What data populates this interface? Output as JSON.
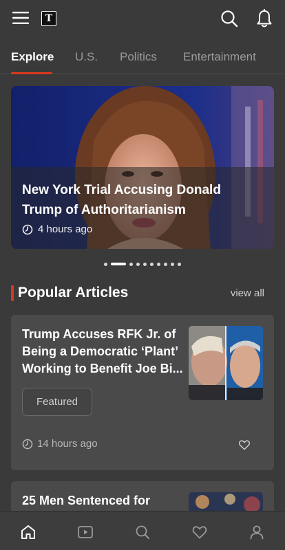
{
  "header": {
    "logo_text": "T",
    "icons": [
      "menu-icon",
      "logo-icon",
      "search-icon",
      "bell-icon"
    ]
  },
  "tabs": [
    {
      "label": "Explore",
      "active": true
    },
    {
      "label": "U.S.",
      "active": false
    },
    {
      "label": "Politics",
      "active": false
    },
    {
      "label": "Entertainment",
      "active": false
    }
  ],
  "hero": {
    "title": "New York Trial Accusing Donald Trump of Authoritarianism",
    "time": "4 hours ago",
    "carousel_count": 10,
    "carousel_active_index": 1
  },
  "popular": {
    "title": "Popular Articles",
    "view_all": "view all"
  },
  "articles": [
    {
      "title": "Trump Accuses RFK Jr. of Being a Democratic ‘Plant’ Working to Benefit Joe Bi...",
      "badge": "Featured",
      "time": "14 hours ago",
      "liked": false
    },
    {
      "title": "25 Men Sentenced for"
    }
  ],
  "bottom_nav": [
    {
      "name": "home",
      "active": true
    },
    {
      "name": "video",
      "active": false
    },
    {
      "name": "search",
      "active": false
    },
    {
      "name": "favorites",
      "active": false
    },
    {
      "name": "profile",
      "active": false
    }
  ],
  "colors": {
    "background": "#3a3a3a",
    "card": "#4a4a4a",
    "accent": "#d9371e",
    "text": "#ffffff",
    "muted": "#9a9a9a"
  }
}
